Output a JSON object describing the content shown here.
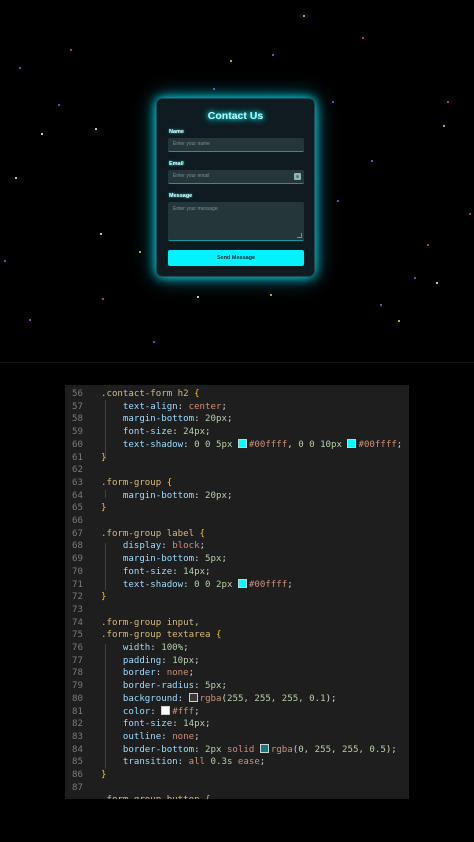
{
  "form": {
    "title": "Contact Us",
    "name_label": "Name",
    "name_placeholder": "Enter your name",
    "email_label": "Email",
    "email_placeholder": "Enter your email",
    "email_badge": "✉",
    "message_label": "Message",
    "message_placeholder": "Enter your message",
    "submit_label": "Send Message"
  },
  "colors": {
    "accent": "#00ffff",
    "button": "#00f3ff",
    "background": "#000000",
    "editor_bg": "#1e1e1e"
  },
  "code": {
    "lines": [
      {
        "n": "56",
        "tokens": [
          {
            "t": ".contact-form h2",
            "c": "sel"
          },
          {
            "t": " {",
            "c": "brace"
          }
        ]
      },
      {
        "n": "57",
        "tokens": [
          {
            "t": "    "
          },
          {
            "t": "text-align",
            "c": "prop"
          },
          {
            "t": ": "
          },
          {
            "t": "center",
            "c": "val"
          },
          {
            "t": ";"
          }
        ]
      },
      {
        "n": "58",
        "tokens": [
          {
            "t": "    "
          },
          {
            "t": "margin-bottom",
            "c": "prop"
          },
          {
            "t": ": "
          },
          {
            "t": "20px",
            "c": "num"
          },
          {
            "t": ";"
          }
        ]
      },
      {
        "n": "59",
        "tokens": [
          {
            "t": "    "
          },
          {
            "t": "font-size",
            "c": "prop"
          },
          {
            "t": ": "
          },
          {
            "t": "24px",
            "c": "num"
          },
          {
            "t": ";"
          }
        ]
      },
      {
        "n": "60",
        "tokens": [
          {
            "t": "    "
          },
          {
            "t": "text-shadow",
            "c": "prop"
          },
          {
            "t": ": "
          },
          {
            "t": "0 0 5px ",
            "c": "num"
          },
          {
            "sw": "#00ffff"
          },
          {
            "t": "#00ffff",
            "c": "val"
          },
          {
            "t": ", "
          },
          {
            "t": "0 0 10px ",
            "c": "num"
          },
          {
            "sw": "#00ffff"
          },
          {
            "t": "#00ffff",
            "c": "val"
          },
          {
            "t": ";"
          }
        ]
      },
      {
        "n": "61",
        "tokens": [
          {
            "t": "}",
            "c": "brace"
          }
        ]
      },
      {
        "n": "62",
        "tokens": []
      },
      {
        "n": "63",
        "tokens": [
          {
            "t": ".form-group",
            "c": "sel"
          },
          {
            "t": " {",
            "c": "brace"
          }
        ]
      },
      {
        "n": "64",
        "tokens": [
          {
            "t": "    "
          },
          {
            "t": "margin-bottom",
            "c": "prop"
          },
          {
            "t": ": "
          },
          {
            "t": "20px",
            "c": "num"
          },
          {
            "t": ";"
          }
        ]
      },
      {
        "n": "65",
        "tokens": [
          {
            "t": "}",
            "c": "brace"
          }
        ]
      },
      {
        "n": "66",
        "tokens": []
      },
      {
        "n": "67",
        "tokens": [
          {
            "t": ".form-group label",
            "c": "sel"
          },
          {
            "t": " {",
            "c": "brace"
          }
        ]
      },
      {
        "n": "68",
        "tokens": [
          {
            "t": "    "
          },
          {
            "t": "display",
            "c": "prop"
          },
          {
            "t": ": "
          },
          {
            "t": "block",
            "c": "val"
          },
          {
            "t": ";"
          }
        ]
      },
      {
        "n": "69",
        "tokens": [
          {
            "t": "    "
          },
          {
            "t": "margin-bottom",
            "c": "prop"
          },
          {
            "t": ": "
          },
          {
            "t": "5px",
            "c": "num"
          },
          {
            "t": ";"
          }
        ]
      },
      {
        "n": "70",
        "tokens": [
          {
            "t": "    "
          },
          {
            "t": "font-size",
            "c": "prop"
          },
          {
            "t": ": "
          },
          {
            "t": "14px",
            "c": "num"
          },
          {
            "t": ";"
          }
        ]
      },
      {
        "n": "71",
        "tokens": [
          {
            "t": "    "
          },
          {
            "t": "text-shadow",
            "c": "prop"
          },
          {
            "t": ": "
          },
          {
            "t": "0 0 2px ",
            "c": "num"
          },
          {
            "sw": "#00ffff"
          },
          {
            "t": "#00ffff",
            "c": "val"
          },
          {
            "t": ";"
          }
        ]
      },
      {
        "n": "72",
        "tokens": [
          {
            "t": "}",
            "c": "brace"
          }
        ]
      },
      {
        "n": "73",
        "tokens": []
      },
      {
        "n": "74",
        "tokens": [
          {
            "t": ".form-group input,",
            "c": "sel"
          }
        ]
      },
      {
        "n": "75",
        "tokens": [
          {
            "t": ".form-group textarea",
            "c": "sel"
          },
          {
            "t": " {",
            "c": "brace"
          }
        ]
      },
      {
        "n": "76",
        "tokens": [
          {
            "t": "    "
          },
          {
            "t": "width",
            "c": "prop"
          },
          {
            "t": ": "
          },
          {
            "t": "100%",
            "c": "num"
          },
          {
            "t": ";"
          }
        ]
      },
      {
        "n": "77",
        "tokens": [
          {
            "t": "    "
          },
          {
            "t": "padding",
            "c": "prop"
          },
          {
            "t": ": "
          },
          {
            "t": "10px",
            "c": "num"
          },
          {
            "t": ";"
          }
        ]
      },
      {
        "n": "78",
        "tokens": [
          {
            "t": "    "
          },
          {
            "t": "border",
            "c": "prop"
          },
          {
            "t": ": "
          },
          {
            "t": "none",
            "c": "val"
          },
          {
            "t": ";"
          }
        ]
      },
      {
        "n": "79",
        "tokens": [
          {
            "t": "    "
          },
          {
            "t": "border-radius",
            "c": "prop"
          },
          {
            "t": ": "
          },
          {
            "t": "5px",
            "c": "num"
          },
          {
            "t": ";"
          }
        ]
      },
      {
        "n": "80",
        "tokens": [
          {
            "t": "    "
          },
          {
            "t": "background",
            "c": "prop"
          },
          {
            "t": ": "
          },
          {
            "sw": "#3a3a3a"
          },
          {
            "t": "rgba",
            "c": "val"
          },
          {
            "t": "("
          },
          {
            "t": "255, 255, 255, 0.1",
            "c": "num"
          },
          {
            "t": ");"
          }
        ]
      },
      {
        "n": "81",
        "tokens": [
          {
            "t": "    "
          },
          {
            "t": "color",
            "c": "prop"
          },
          {
            "t": ": "
          },
          {
            "sw": "#ffffff"
          },
          {
            "t": "#fff",
            "c": "val"
          },
          {
            "t": ";"
          }
        ]
      },
      {
        "n": "82",
        "tokens": [
          {
            "t": "    "
          },
          {
            "t": "font-size",
            "c": "prop"
          },
          {
            "t": ": "
          },
          {
            "t": "14px",
            "c": "num"
          },
          {
            "t": ";"
          }
        ]
      },
      {
        "n": "83",
        "tokens": [
          {
            "t": "    "
          },
          {
            "t": "outline",
            "c": "prop"
          },
          {
            "t": ": "
          },
          {
            "t": "none",
            "c": "val"
          },
          {
            "t": ";"
          }
        ]
      },
      {
        "n": "84",
        "tokens": [
          {
            "t": "    "
          },
          {
            "t": "border-bottom",
            "c": "prop"
          },
          {
            "t": ": "
          },
          {
            "t": "2px ",
            "c": "num"
          },
          {
            "t": "solid ",
            "c": "val"
          },
          {
            "sw": "#107c80"
          },
          {
            "t": "rgba",
            "c": "val"
          },
          {
            "t": "("
          },
          {
            "t": "0, 255, 255, 0.5",
            "c": "num"
          },
          {
            "t": ");"
          }
        ]
      },
      {
        "n": "85",
        "tokens": [
          {
            "t": "    "
          },
          {
            "t": "transition",
            "c": "prop"
          },
          {
            "t": ": "
          },
          {
            "t": "all ",
            "c": "val"
          },
          {
            "t": "0.3s ",
            "c": "num"
          },
          {
            "t": "ease",
            "c": "val"
          },
          {
            "t": ";"
          }
        ]
      },
      {
        "n": "86",
        "tokens": [
          {
            "t": "}",
            "c": "brace"
          }
        ]
      },
      {
        "n": "87",
        "tokens": []
      },
      {
        "n": "",
        "tokens": [
          {
            "t": ".form-group button {",
            "c": "sel"
          }
        ]
      }
    ]
  }
}
